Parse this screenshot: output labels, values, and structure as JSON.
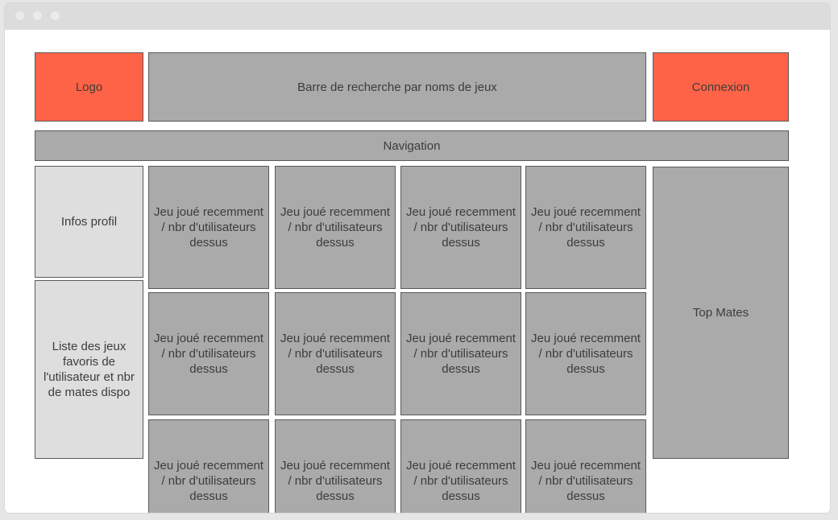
{
  "window": {
    "controls": [
      "close",
      "minimize",
      "maximize"
    ]
  },
  "header": {
    "logo_label": "Logo",
    "search_label": "Barre de recherche par noms de jeux",
    "login_label": "Connexion"
  },
  "nav": {
    "label": "Navigation"
  },
  "sidebar": {
    "profile_label": "Infos profil",
    "favorites_label": "Liste des jeux favoris de l'utilisateur et nbr de mates dispo"
  },
  "games": {
    "tiles": [
      "Jeu joué recemment / nbr d'utilisateurs dessus",
      "Jeu joué recemment / nbr d'utilisateurs dessus",
      "Jeu joué recemment / nbr d'utilisateurs dessus",
      "Jeu joué recemment / nbr d'utilisateurs dessus",
      "Jeu joué recemment / nbr d'utilisateurs dessus",
      "Jeu joué recemment / nbr d'utilisateurs dessus",
      "Jeu joué recemment / nbr d'utilisateurs dessus",
      "Jeu joué recemment / nbr d'utilisateurs dessus",
      "Jeu joué recemment / nbr d'utilisateurs dessus",
      "Jeu joué recemment / nbr d'utilisateurs dessus",
      "Jeu joué recemment / nbr d'utilisateurs dessus",
      "Jeu joué recemment / nbr d'utilisateurs dessus"
    ]
  },
  "right_panel": {
    "top_mates_label": "Top Mates"
  },
  "colors": {
    "accent": "#ff6347",
    "block_gray": "#aaaaaa",
    "block_light": "#dedede",
    "titlebar": "#dcdcdc"
  }
}
